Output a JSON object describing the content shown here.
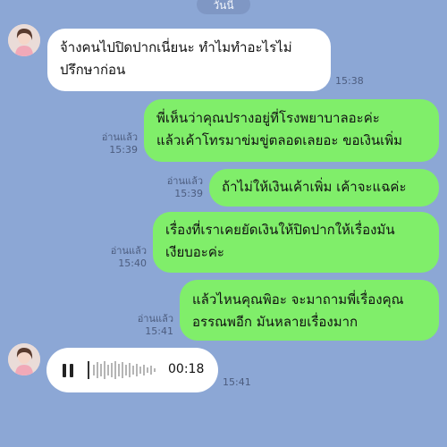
{
  "header": {
    "date_label": "วันนี้"
  },
  "messages": [
    {
      "lines": [
        "จ้างคนไปปิดปากเนี่ยนะ ทำไมทำอะไรไม่",
        "ปรึกษาก่อน"
      ],
      "time": "15:38"
    },
    {
      "lines": [
        "พี่เห็นว่าคุณปรางอยู่ที่โรงพยาบาลอะค่ะ",
        "แล้วเค้าโทรมาข่มขู่ตลอดเลยอะ ขอเงินเพิ่ม"
      ],
      "read": "อ่านแล้ว",
      "time": "15:39"
    },
    {
      "lines": [
        "ถ้าไม่ให้เงินเค้าเพิ่ม เค้าจะแฉค่ะ"
      ],
      "read": "อ่านแล้ว",
      "time": "15:39"
    },
    {
      "lines": [
        "เรื่องที่เราเคยยัดเงินให้ปิดปากให้เรื่องมัน",
        "เงียบอะค่ะ"
      ],
      "read": "อ่านแล้ว",
      "time": "15:40"
    },
    {
      "lines": [
        "แล้วไหนคุณพิอะ จะมาถามพี่เรื่องคุณ",
        "อรรณพอีก มันหลายเรื่องมาก"
      ],
      "read": "อ่านแล้ว",
      "time": "15:41"
    }
  ],
  "voice_message": {
    "duration": "00:18",
    "time": "15:41",
    "icon": "pause-icon"
  },
  "colors": {
    "background": "#8ca7d5",
    "outgoing_bubble": "#80ee6a",
    "incoming_bubble": "#ffffff"
  }
}
